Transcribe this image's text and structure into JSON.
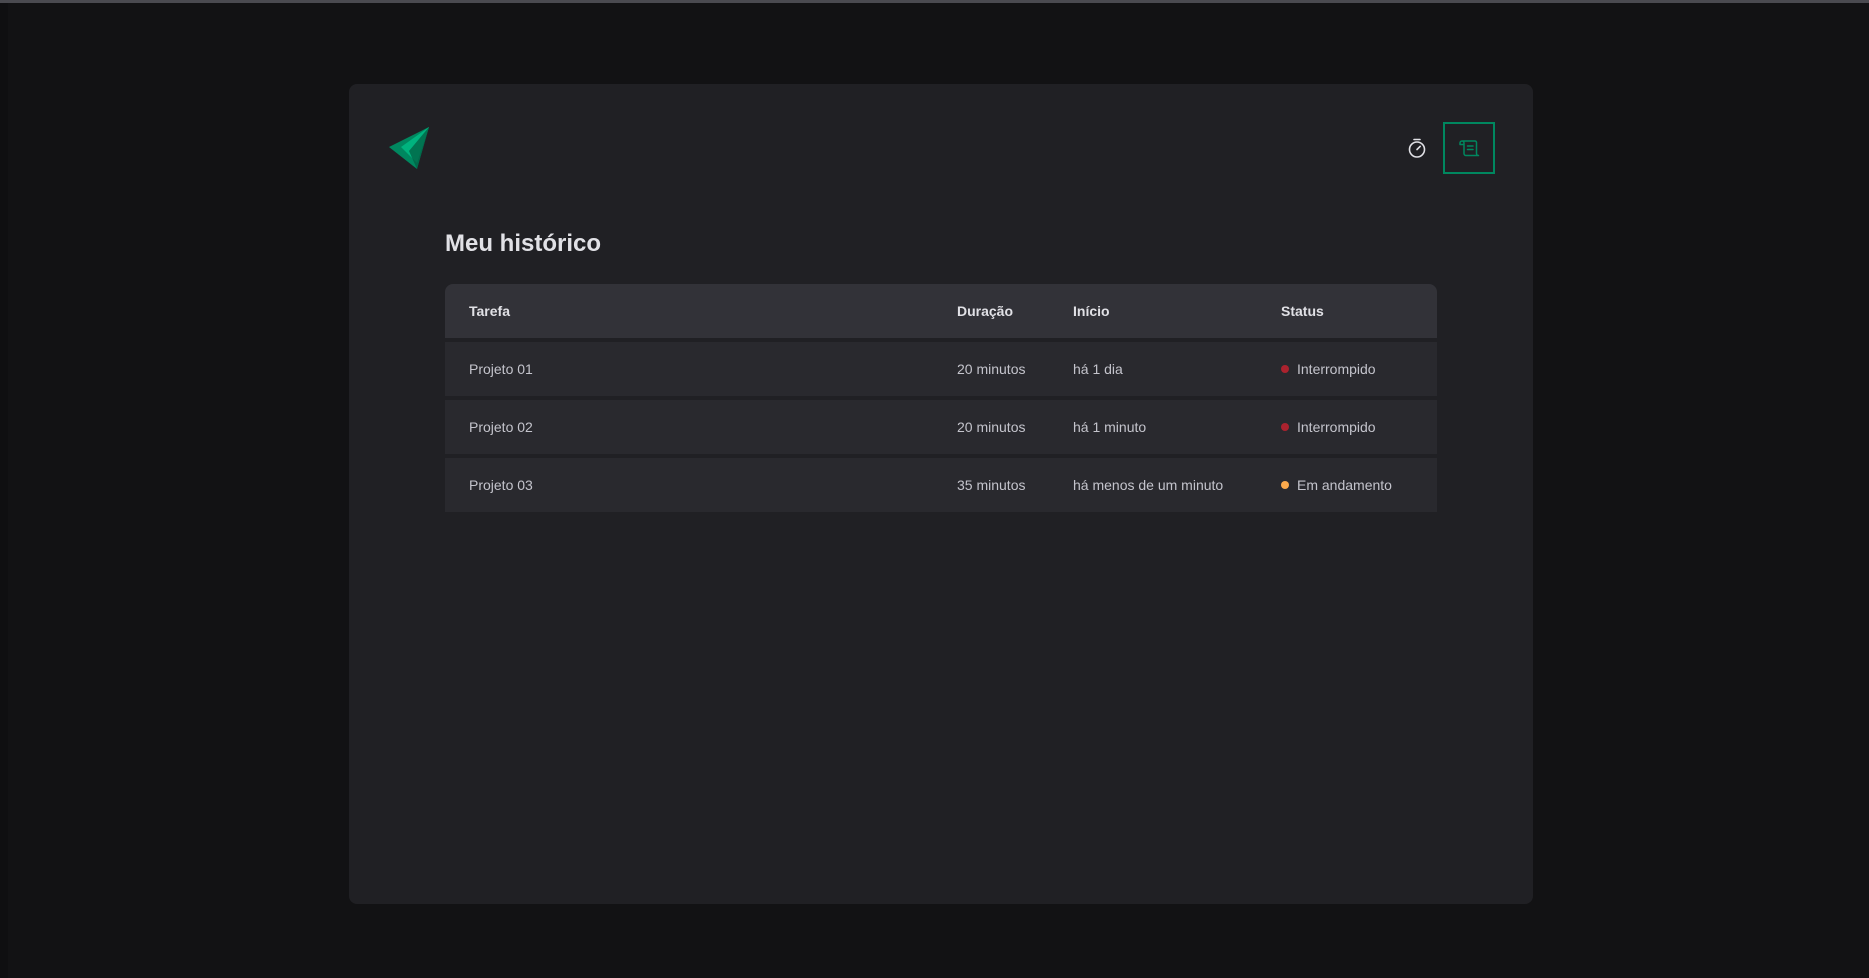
{
  "page": {
    "title": "Meu histórico"
  },
  "header": {
    "logo": "ignite-timer-logo",
    "nav": [
      {
        "name": "timer",
        "icon": "timer-icon",
        "active": false
      },
      {
        "name": "history",
        "icon": "scroll-icon",
        "active": true
      }
    ]
  },
  "table": {
    "headers": [
      "Tarefa",
      "Duração",
      "Início",
      "Status"
    ],
    "rows": [
      {
        "task": "Projeto 01",
        "duration": "20 minutos",
        "start": "há 1 dia",
        "status": "Interrompido",
        "status_color": "#AB222E"
      },
      {
        "task": "Projeto 02",
        "duration": "20 minutos",
        "start": "há 1 minuto",
        "status": "Interrompido",
        "status_color": "#AB222E"
      },
      {
        "task": "Projeto 03",
        "duration": "35 minutos",
        "start": "há menos de um minuto",
        "status": "Em andamento",
        "status_color": "#FBA94C"
      }
    ]
  },
  "colors": {
    "background": "#121214",
    "card": "#202024",
    "header_row": "#323238",
    "row": "#29292E",
    "accent": "#00875F",
    "logo_light": "#00B37E",
    "logo_dark": "#00875F"
  }
}
